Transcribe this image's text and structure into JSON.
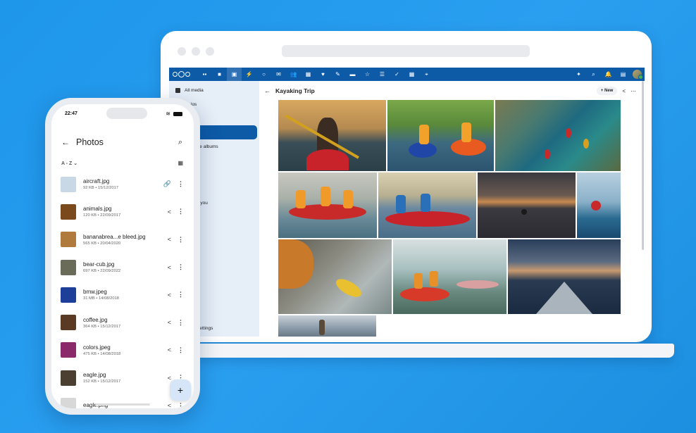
{
  "laptop": {
    "sidebar": {
      "items": [
        {
          "label": "All media",
          "active": false
        },
        {
          "label": "los",
          "active": false
        },
        {
          "label": "",
          "active": true
        },
        {
          "label": "rative albums",
          "active": false
        },
        {
          "label": "s",
          "active": false
        },
        {
          "label": "day",
          "active": false
        },
        {
          "label": "with you",
          "active": false
        }
      ],
      "settings_label": "settings"
    },
    "content": {
      "back_icon": "arrow-left-icon",
      "title": "Kayaking Trip",
      "new_label": "+ New",
      "share_icon": "share-icon",
      "more_icon": "more-horizontal-icon"
    },
    "topbar": {
      "left_icons": [
        "dashboard-icon",
        "files-icon",
        "photos-icon",
        "activity-icon",
        "search-icon",
        "mail-icon",
        "contacts-icon",
        "calendar-icon",
        "heart-icon",
        "pencil-icon",
        "deck-icon",
        "star-icon",
        "list-icon",
        "check-icon",
        "table-icon",
        "map-pin-icon"
      ],
      "right_icons": [
        "sparkle-icon",
        "search-icon",
        "bell-icon",
        "contacts-menu-icon"
      ]
    },
    "photos": [
      {
        "name": "kayak-girl-sunset"
      },
      {
        "name": "two-kayakers-lake"
      },
      {
        "name": "aerial-kayaks-river"
      },
      {
        "name": "group-kayaking"
      },
      {
        "name": "couple-kayak-blue"
      },
      {
        "name": "sunset-lake-silhouette"
      },
      {
        "name": "kayak-waves"
      },
      {
        "name": "kayak-paddle-closeup"
      },
      {
        "name": "couple-red-kayak"
      },
      {
        "name": "kayak-bow-sunset"
      },
      {
        "name": "standup-paddle"
      }
    ]
  },
  "phone": {
    "time": "22:47",
    "title": "Photos",
    "sort_label": "A - Z ⌄",
    "fab_label": "+",
    "files": [
      {
        "name": "aircraft.jpg",
        "meta": "92 KB • 15/12/2017",
        "action": "link-icon",
        "color": "#c9d8e6"
      },
      {
        "name": "animals.jpg",
        "meta": "120 KB • 22/09/2017",
        "action": "share-icon",
        "color": "#7a4a1c"
      },
      {
        "name": "bananabrea...e bleed.jpg",
        "meta": "565 KB • 20/04/2020",
        "action": "share-icon",
        "color": "#b07a3c"
      },
      {
        "name": "bear-cub.jpg",
        "meta": "697 KB • 22/09/2022",
        "action": "share-icon",
        "color": "#6b6b5a"
      },
      {
        "name": "bmw.jpeg",
        "meta": "31 MB • 14/08/2018",
        "action": "share-icon",
        "color": "#1d3f9a"
      },
      {
        "name": "coffee.jpg",
        "meta": "364 KB • 15/12/2017",
        "action": "share-icon",
        "color": "#5a3a22"
      },
      {
        "name": "colors.jpeg",
        "meta": "475 KB • 14/08/2018",
        "action": "share-icon",
        "color": "#8a2a6a"
      },
      {
        "name": "eagle.jpg",
        "meta": "152 KB • 15/12/2017",
        "action": "share-icon",
        "color": "#4a3f30"
      },
      {
        "name": "eagle.png",
        "meta": "",
        "action": "share-icon",
        "color": "#d8d8d8"
      }
    ]
  }
}
